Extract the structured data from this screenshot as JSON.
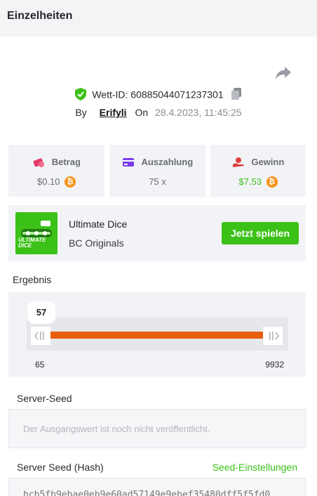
{
  "header": {
    "title": "Einzelheiten"
  },
  "bet": {
    "id_text": "Wett-ID: 60885044071237301",
    "by_label": "By",
    "user": "Erifyli",
    "on_label": "On",
    "date": "28.4.2023, 11:45:25"
  },
  "stats": {
    "betrag": {
      "label": "Betrag",
      "value": "$0.10"
    },
    "auszahlung": {
      "label": "Auszahlung",
      "value": "75 x"
    },
    "gewinn": {
      "label": "Gewinn",
      "value": "$7.53"
    }
  },
  "coin_symbol": "₿",
  "game": {
    "name": "Ultimate Dice",
    "provider": "BC Originals",
    "thumb_label": "ULTIMATE DICE",
    "play_label": "Jetzt spielen"
  },
  "result": {
    "label": "Ergebnis",
    "value": "57",
    "range_min": "65",
    "range_max": "9932",
    "fill_fraction": 1.0
  },
  "server_seed": {
    "label": "Server-Seed",
    "placeholder": "Der Ausgangswert ist noch nicht veröffentlicht."
  },
  "server_seed_hash": {
    "label": "Server Seed (Hash)",
    "settings_link": "Seed-Einstellungen",
    "value_partial": "bcb5fb9ebae0eb9e60ad57149e9ebef35480dff5f5fd0"
  },
  "colors": {
    "accent_green": "#3bc117",
    "bar_orange": "#e85e0d",
    "bitcoin_orange": "#f7931a",
    "panel_bg": "#f2f3f6"
  }
}
